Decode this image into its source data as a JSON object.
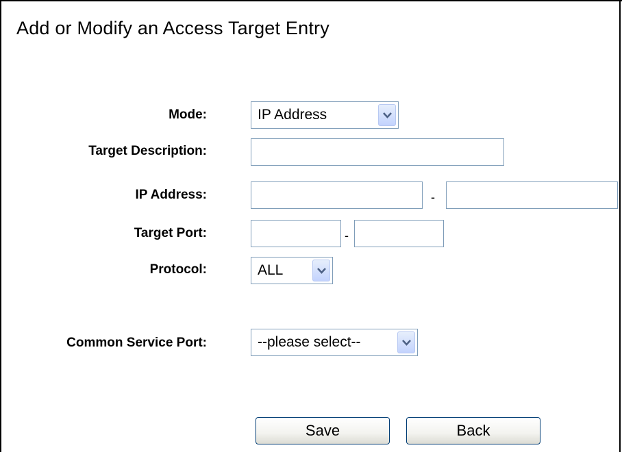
{
  "page": {
    "title": "Add or Modify an Access Target Entry"
  },
  "form": {
    "mode": {
      "label": "Mode:",
      "value": "IP Address"
    },
    "target_description": {
      "label": "Target Description:",
      "value": ""
    },
    "ip_address": {
      "label": "IP Address:",
      "start": "",
      "end": "",
      "separator": "-"
    },
    "target_port": {
      "label": "Target Port:",
      "start": "",
      "end": "",
      "separator": "-"
    },
    "protocol": {
      "label": "Protocol:",
      "value": "ALL"
    },
    "common_service_port": {
      "label": "Common Service Port:",
      "value": "--please select--"
    }
  },
  "buttons": {
    "save": "Save",
    "back": "Back"
  },
  "icons": {
    "dropdown": "chevron-down-icon"
  },
  "colors": {
    "input_border": "#7f9db9",
    "button_border": "#003c74",
    "dropdown_arrow": "#4d6185"
  }
}
